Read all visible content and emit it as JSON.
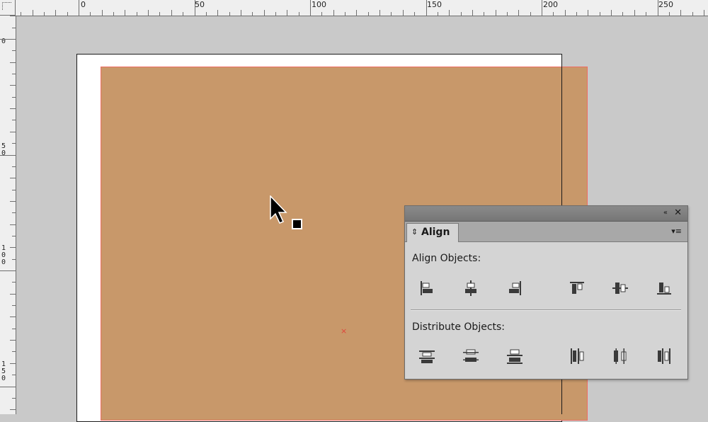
{
  "ruler": {
    "top_labels": [
      "0",
      "50",
      "100",
      "150",
      "200",
      "250"
    ],
    "left_labels": [
      "0",
      "5\n0",
      "1\n0\n0",
      "1\n5\n0"
    ]
  },
  "canvas": {
    "page_color": "#ffffff",
    "rect_fill": "#c8986a",
    "rect_stroke": "#ee6b62",
    "pasteboard_color": "#c9c9c9",
    "center_marker": "×"
  },
  "panel": {
    "collapse_icon": "«",
    "close_icon": "✕",
    "tab_arrows": "⇕",
    "tab_label": "Align",
    "menu_icon": "▾≡",
    "align_objects_label": "Align Objects:",
    "distribute_objects_label": "Distribute Objects:",
    "align_buttons": [
      {
        "name": "align-left-edges",
        "icon": "align-left-icon"
      },
      {
        "name": "align-horizontal-centers",
        "icon": "align-horizontal-center-icon"
      },
      {
        "name": "align-right-edges",
        "icon": "align-right-icon"
      },
      {
        "name": "align-top-edges",
        "icon": "align-top-icon"
      },
      {
        "name": "align-vertical-centers",
        "icon": "align-vertical-center-icon"
      },
      {
        "name": "align-bottom-edges",
        "icon": "align-bottom-icon"
      }
    ],
    "distribute_buttons": [
      {
        "name": "distribute-top-edges",
        "icon": "distribute-top-icon"
      },
      {
        "name": "distribute-vertical-centers",
        "icon": "distribute-vertical-center-icon"
      },
      {
        "name": "distribute-bottom-edges",
        "icon": "distribute-bottom-icon"
      },
      {
        "name": "distribute-left-edges",
        "icon": "distribute-left-icon"
      },
      {
        "name": "distribute-horizontal-centers",
        "icon": "distribute-horizontal-center-icon"
      },
      {
        "name": "distribute-right-edges",
        "icon": "distribute-right-icon"
      }
    ]
  }
}
